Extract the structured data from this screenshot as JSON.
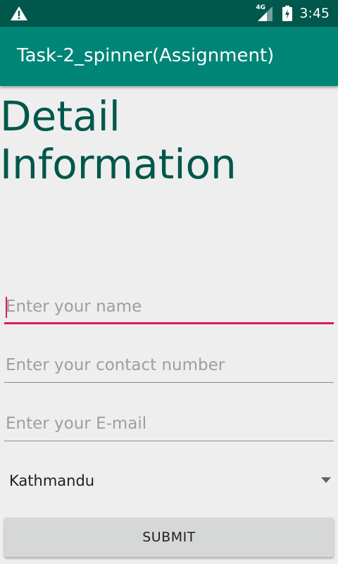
{
  "status_bar": {
    "icons": [
      "warning-icon",
      "signal-icon",
      "battery-charging-icon"
    ],
    "network": "4G",
    "time": "3:45"
  },
  "app_bar": {
    "title": "Task-2_spinner(Assignment)"
  },
  "form": {
    "heading_line1": "Detail",
    "heading_line2": "Information",
    "name_placeholder": "Enter your name",
    "contact_placeholder": "Enter your contact number",
    "email_placeholder": "Enter your E-mail",
    "city_selected": "Kathmandu",
    "submit_label": "SUBMIT"
  },
  "colors": {
    "status_bar": "#00574b",
    "app_bar": "#008577",
    "accent": "#d81b60",
    "heading": "#00574b"
  }
}
